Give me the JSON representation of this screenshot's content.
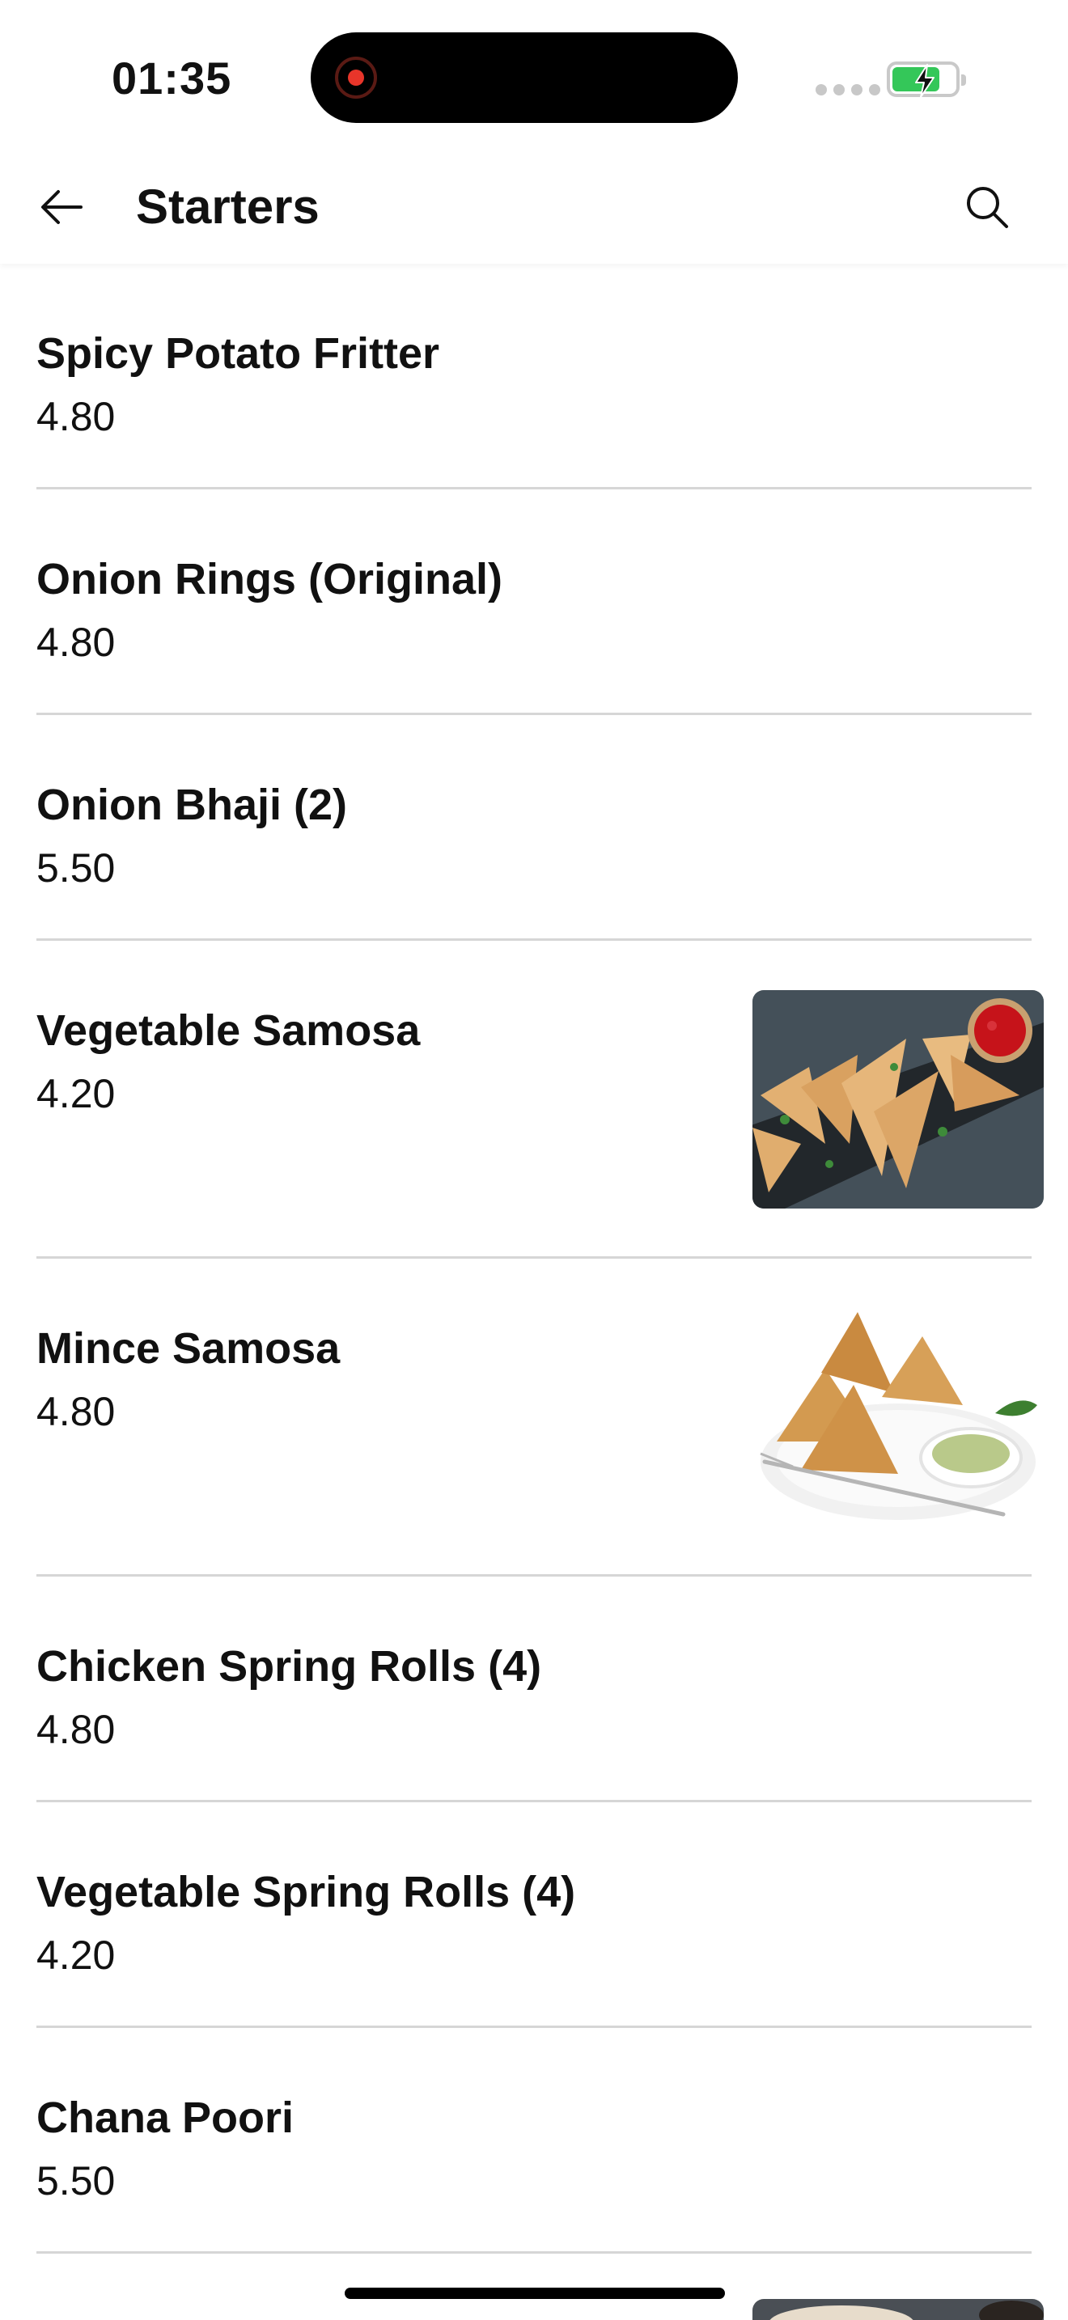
{
  "status_bar": {
    "time": "01:35"
  },
  "header": {
    "title": "Starters"
  },
  "items": [
    {
      "name": "Spicy Potato Fritter",
      "price": "4.80"
    },
    {
      "name": "Onion Rings (Original)",
      "price": "4.80"
    },
    {
      "name": "Onion Bhaji (2)",
      "price": "5.50"
    },
    {
      "name": "Vegetable Samosa",
      "price": "4.20"
    },
    {
      "name": "Mince Samosa",
      "price": "4.80"
    },
    {
      "name": "Chicken Spring Rolls (4)",
      "price": "4.80"
    },
    {
      "name": "Vegetable Spring Rolls (4)",
      "price": "4.20"
    },
    {
      "name": "Chana Poori",
      "price": "5.50"
    }
  ],
  "icons": {
    "back": "arrow-left-icon",
    "search": "search-icon",
    "recording": "recording-icon",
    "battery": "battery-charging-icon"
  },
  "colors": {
    "recording_red": "#e8352a",
    "battery_green": "#34c759",
    "divider": "#d6d6d6"
  }
}
